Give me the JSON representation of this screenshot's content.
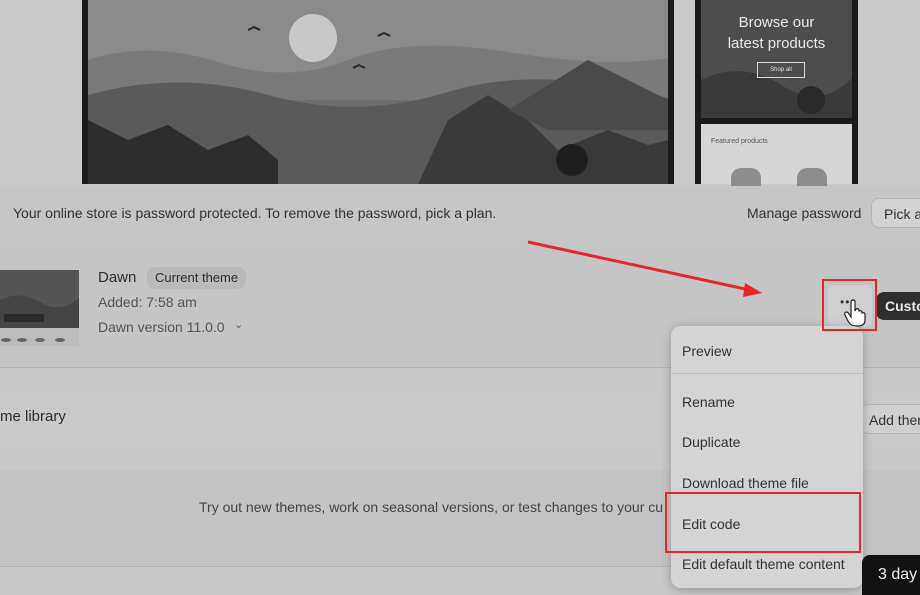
{
  "preview": {
    "mobile_title_line1": "Browse our",
    "mobile_title_line2": "latest products",
    "mobile_shop_button": "Shop all",
    "mobile_featured_label": "Featured products"
  },
  "banner": {
    "message": "Your online store is password protected. To remove the password, pick a plan.",
    "manage_password": "Manage password",
    "pick_plan": "Pick a"
  },
  "current_theme": {
    "name": "Dawn",
    "badge": "Current theme",
    "added": "Added: 7:58 am",
    "version": "Dawn version 11.0.0",
    "more_icon": "ellipsis-icon",
    "customize": "Custo"
  },
  "theme_library": {
    "title": "me library",
    "add_theme": "Add ther",
    "empty_text": "Try out new themes, work on seasonal versions, or test changes to your cu"
  },
  "menu": {
    "items": [
      "Preview",
      "Rename",
      "Duplicate",
      "Download theme file",
      "Edit code",
      "Edit default theme content"
    ]
  },
  "trial": {
    "label": "3 day"
  },
  "colors": {
    "annotation": "#e8262a",
    "customize_bg": "#2f2f2f"
  }
}
